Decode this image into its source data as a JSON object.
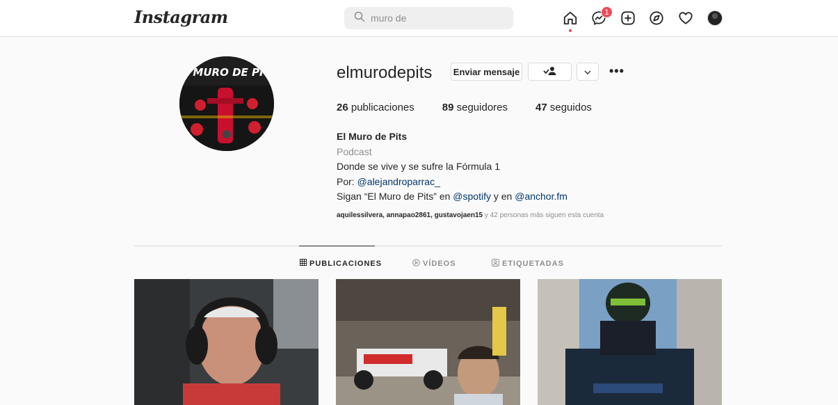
{
  "header": {
    "logo": "Instagram",
    "search_value": "muro de",
    "messages_badge": "1",
    "icons": [
      "home-icon",
      "messenger-icon",
      "new-post-icon",
      "explore-icon",
      "activity-heart-icon",
      "profile-avatar"
    ]
  },
  "profile": {
    "username": "elmurodepits",
    "avatar_text": "EL MURO DE PITS",
    "buttons": {
      "message": "Enviar mensaje",
      "follow_icon": "following-person-icon",
      "dropdown_icon": "chevron-down-icon",
      "more": "•••"
    },
    "stats": {
      "posts_count": "26",
      "posts_label": "publicaciones",
      "followers_count": "89",
      "followers_label": "seguidores",
      "following_count": "47",
      "following_label": "seguidos"
    },
    "bio": {
      "name": "El Muro de Pits",
      "category": "Podcast",
      "line1": "Donde se vive y se sufre la Fórmula 1",
      "line2_prefix": "Por: ",
      "line2_link": "@alejandroparrac_",
      "line3_prefix": "Sigan “El Muro de Pits” en ",
      "line3_link1": "@spotify",
      "line3_mid": " y en ",
      "line3_link2": "@anchor.fm"
    },
    "followed_by": {
      "users": "aquilessilvera, annapao2861, gustavojaen15",
      "suffix": " y 42 personas más siguen esta cuenta"
    }
  },
  "tabs": [
    {
      "label": "PUBLICACIONES",
      "icon": "grid-icon",
      "active": true
    },
    {
      "label": "VÍDEOS",
      "icon": "play-circle-icon",
      "active": false
    },
    {
      "label": "ETIQUETADAS",
      "icon": "tagged-icon",
      "active": false
    }
  ],
  "colors": {
    "accent_red": "#ed4956",
    "link": "#00376b",
    "border": "#dbdbdb"
  }
}
